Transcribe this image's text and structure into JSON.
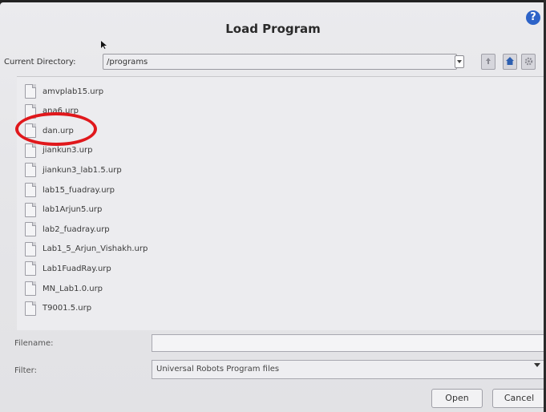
{
  "dialog": {
    "title": "Load Program"
  },
  "directory": {
    "label": "Current Directory:",
    "value": "/programs"
  },
  "files": [
    "amvplab15.urp",
    "ana6.urp",
    "dan.urp",
    "jiankun3.urp",
    "jiankun3_lab1.5.urp",
    "lab15_fuadray.urp",
    "lab1Arjun5.urp",
    "lab2_fuadray.urp",
    "Lab1_5_Arjun_Vishakh.urp",
    "Lab1FuadRay.urp",
    "MN_Lab1.0.urp",
    "T9001.5.urp"
  ],
  "filename": {
    "label": "Filename:",
    "value": ""
  },
  "filter": {
    "label": "Filter:",
    "value": "Universal Robots Program files"
  },
  "buttons": {
    "open": "Open",
    "cancel": "Cancel"
  },
  "icons": {
    "help": "?",
    "highlight_color": "#e0181c"
  }
}
